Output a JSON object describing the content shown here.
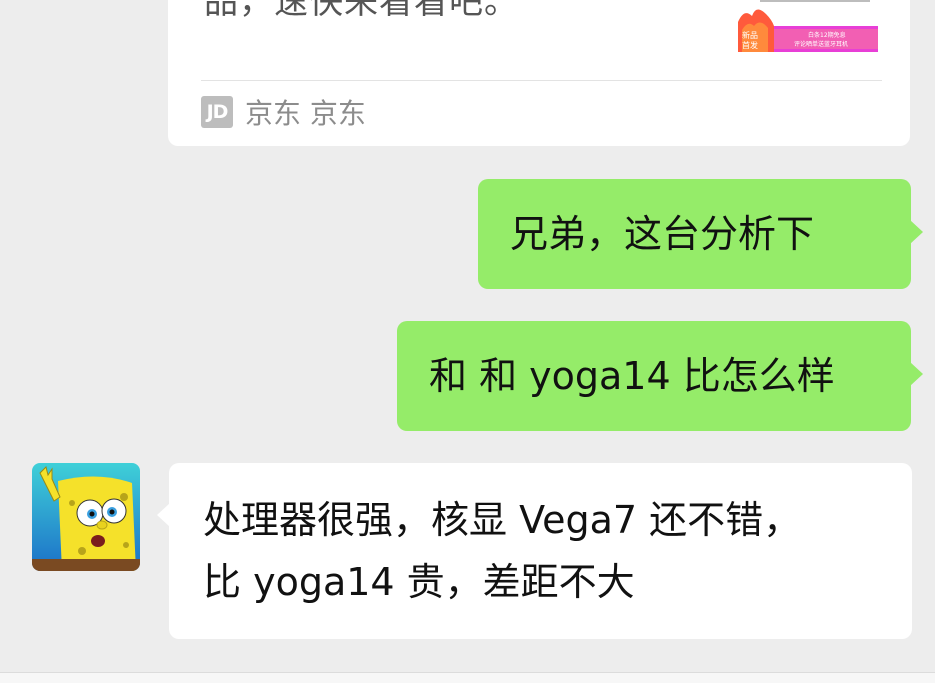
{
  "card": {
    "description_fragment": "品，速快来看看吧。",
    "source_name": "京东 京东",
    "logo_text": "JD",
    "thumb_badge": "新品",
    "thumb_badge2": "首发",
    "thumb_caption": "白条12期免息",
    "thumb_caption2": "评论晒单送蓝牙耳机"
  },
  "messages": [
    {
      "from": "me",
      "text": "兄弟，这台分析下"
    },
    {
      "from": "me",
      "text": "和 和 yoga14 比怎么样"
    },
    {
      "from": "other",
      "lines": [
        "处理器很强，核显 Vega7 还不错，",
        "比 yoga14 贵，差距不大"
      ]
    }
  ],
  "colors": {
    "background": "#ededed",
    "my_bubble": "#95ec69",
    "other_bubble": "#ffffff"
  },
  "icons": {
    "source_logo": "jd-logo-icon",
    "contact_avatar": "spongebob-avatar"
  }
}
